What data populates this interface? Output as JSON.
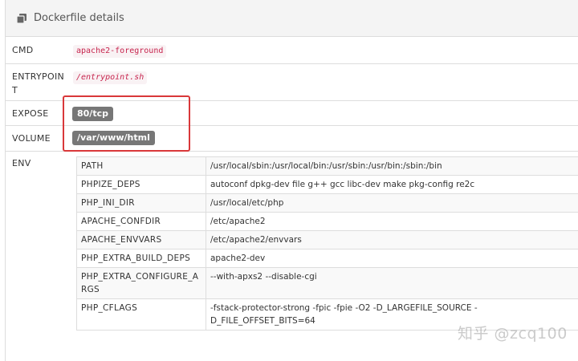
{
  "header": {
    "title": "Dockerfile details",
    "icon": "copy-icon"
  },
  "rows": {
    "cmd": {
      "label": "CMD",
      "value": "apache2-foreground"
    },
    "entrypoint": {
      "label": "ENTRYPOINT",
      "value": "/entrypoint.sh"
    },
    "expose": {
      "label": "EXPOSE",
      "value": "80/tcp"
    },
    "volume": {
      "label": "VOLUME",
      "value": "/var/www/html"
    },
    "env": {
      "label": "ENV"
    }
  },
  "env": [
    {
      "key": "PATH",
      "value": "/usr/local/sbin:/usr/local/bin:/usr/sbin:/usr/bin:/sbin:/bin"
    },
    {
      "key": "PHPIZE_DEPS",
      "value": "autoconf dpkg-dev file g++ gcc libc-dev make pkg-config re2c"
    },
    {
      "key": "PHP_INI_DIR",
      "value": "/usr/local/etc/php"
    },
    {
      "key": "APACHE_CONFDIR",
      "value": "/etc/apache2"
    },
    {
      "key": "APACHE_ENVVARS",
      "value": "/etc/apache2/envvars"
    },
    {
      "key": "PHP_EXTRA_BUILD_DEPS",
      "value": "apache2-dev"
    },
    {
      "key": "PHP_EXTRA_CONFIGURE_ARGS",
      "value": "--with-apxs2 --disable-cgi"
    },
    {
      "key": "PHP_CFLAGS",
      "value": "-fstack-protector-strong -fpic -fpie -O2 -D_LARGEFILE_SOURCE -D_FILE_OFFSET_BITS=64"
    }
  ],
  "watermark": "知乎 @zcq100",
  "colors": {
    "highlight": "#d9383a",
    "badge": "#777777",
    "code_text": "#c7254e",
    "code_bg": "#f9f2f4",
    "header_bg": "#f4f4f4"
  }
}
